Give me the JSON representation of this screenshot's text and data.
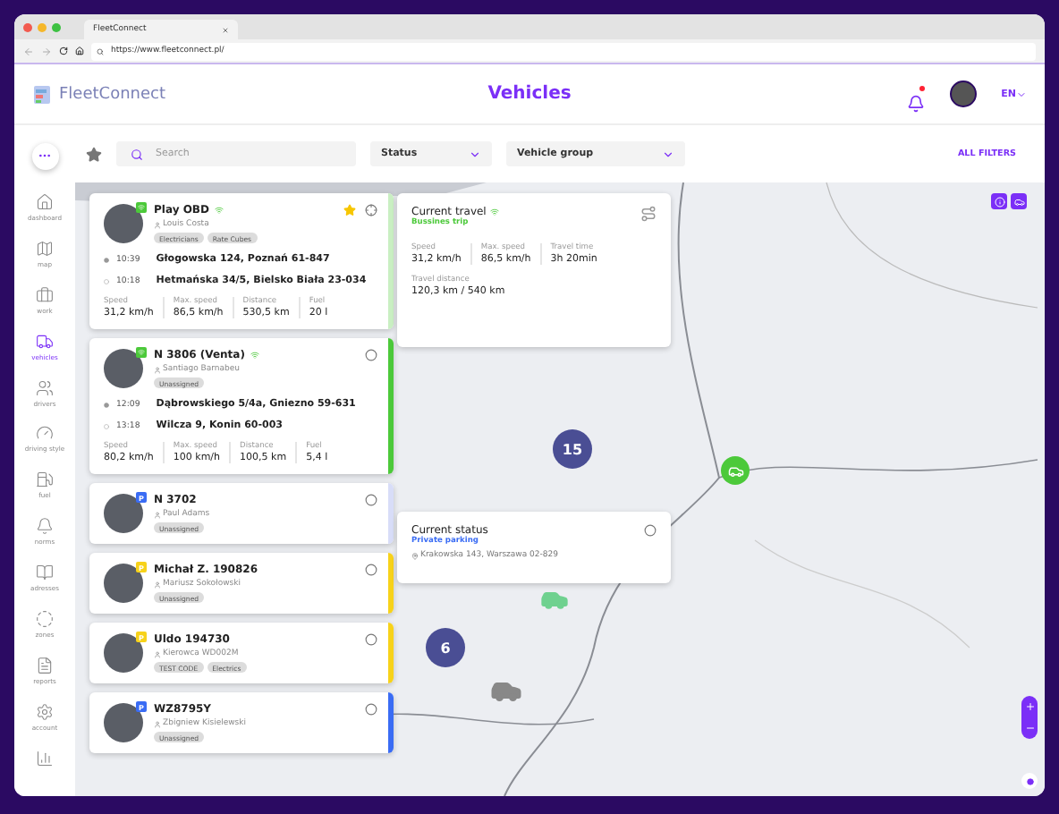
{
  "browser": {
    "tab_title": "FleetConnect",
    "url": "https://www.fleetconnect.pl/"
  },
  "header": {
    "logo": "FleetConnect",
    "title": "Vehicles",
    "notification": true,
    "language": "EN"
  },
  "sidebar": {
    "items": [
      {
        "label": "dashboard",
        "selected": false
      },
      {
        "label": "map",
        "selected": false
      },
      {
        "label": "work",
        "selected": false
      },
      {
        "label": "vehicles",
        "selected": true
      },
      {
        "label": "drivers",
        "selected": false
      },
      {
        "label": "driving style",
        "selected": false
      },
      {
        "label": "fuel",
        "selected": false
      },
      {
        "label": "norms",
        "selected": false
      },
      {
        "label": "adresses",
        "selected": false
      },
      {
        "label": "zones",
        "selected": false
      },
      {
        "label": "reports",
        "selected": false
      },
      {
        "label": "account",
        "selected": false
      },
      {
        "selected": false
      }
    ]
  },
  "filters": {
    "search": {
      "placeholder": "Search"
    },
    "dropdowns": [
      "Status",
      "Vehicle group"
    ],
    "all_filters": "ALL FILTERS"
  },
  "vehicles": [
    {
      "name": "Play OBD",
      "driver": "Louis Costa",
      "tags": [
        "Electricians",
        "Rate Cubes"
      ],
      "online": true,
      "favorite": true,
      "selected": true,
      "color": "#c9efc2",
      "route": [
        {
          "time": "10:39",
          "address": "Głogowska 124, Poznań 61-847"
        },
        {
          "time": "10:18",
          "address": "Hetmańska 34/5, Bielsko Biała 23-034"
        }
      ],
      "stats": [
        {
          "label": "Speed",
          "value": "31,2 km/h"
        },
        {
          "label": "Max. speed",
          "value": "86,5 km/h"
        },
        {
          "label": "Distance",
          "value": "530,5 km"
        },
        {
          "label": "Fuel",
          "value": "20 l"
        }
      ]
    },
    {
      "name": "N 3806 (Venta)",
      "driver": "Santiago Barnabeu",
      "tags": [
        "Unassigned"
      ],
      "online": true,
      "favorite": false,
      "selected": false,
      "color": "#4cc93a",
      "route": [
        {
          "time": "12:09",
          "address": "Dąbrowskiego 5/4a, Gniezno 59-631"
        },
        {
          "time": "13:18",
          "address": "Wilcza 9, Konin 60-003"
        }
      ],
      "stats": [
        {
          "label": "Speed",
          "value": "80,2 km/h"
        },
        {
          "label": "Max. speed",
          "value": "100 km/h"
        },
        {
          "label": "Distance",
          "value": "100,5 km"
        },
        {
          "label": "Fuel",
          "value": "5,4 l"
        }
      ]
    },
    {
      "name": "N 3702",
      "driver": "Paul Adams",
      "tags": [
        "Unassigned"
      ],
      "online": false,
      "badge": "P",
      "favorite": false,
      "selected": false,
      "color": "#d8ddf8"
    },
    {
      "name": "Michał Z. 190826",
      "driver": "Mariusz Sokołowski",
      "tags": [
        "Unassigned"
      ],
      "online": false,
      "badge": "P",
      "favorite": false,
      "selected": false,
      "color": "#f7d21a"
    },
    {
      "name": "Uldo 194730",
      "driver": "Kierowca WD002M",
      "tags": [
        "TEST CODE",
        "Electrics"
      ],
      "online": false,
      "badge": "P",
      "favorite": false,
      "selected": false,
      "color": "#f7d21a"
    },
    {
      "name": "WZ8795Y",
      "driver": "Zbigniew Kisielewski",
      "tags": [
        "Unassigned"
      ],
      "online": false,
      "badge": "P",
      "favorite": false,
      "selected": false,
      "color": "#3a6cf4"
    }
  ],
  "current_travel": {
    "title": "Current travel",
    "online": true,
    "trip_type": "Bussines trip",
    "stats": [
      {
        "label": "Speed",
        "value": "31,2 km/h"
      },
      {
        "label": "Max. speed",
        "value": "86,5 km/h"
      },
      {
        "label": "Travel time",
        "value": "3h 20min"
      }
    ],
    "distance_label": "Travel distance",
    "distance": "120,3 km / 540 km"
  },
  "current_status": {
    "title": "Current status",
    "status": "Private parking",
    "address": "Krakowska 143, Warszawa 02-829"
  },
  "map": {
    "clusters": [
      "15",
      "6"
    ]
  }
}
